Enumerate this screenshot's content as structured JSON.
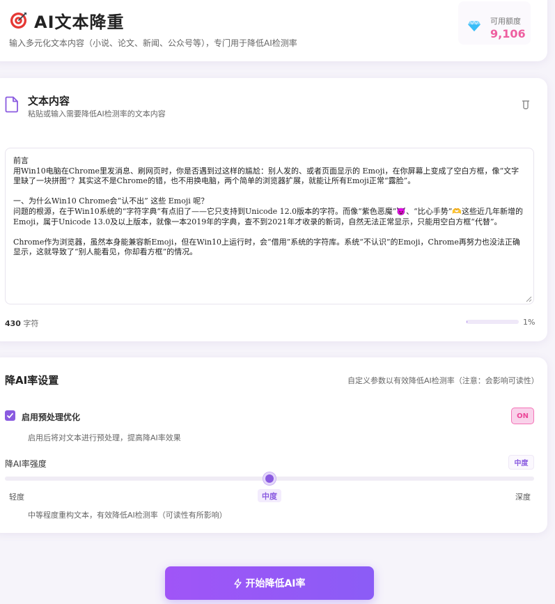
{
  "header": {
    "title": "AI文本降重",
    "subtitle": "输入多元化文本内容（小说、论文、新闻、公众号等），专门用于降低AI检测率",
    "quota_label": "可用额度",
    "quota_value": "9,106"
  },
  "text_section": {
    "title": "文本内容",
    "description": "粘贴或输入需要降低AI检测率的文本内容",
    "content": "前言\n用Win10电脑在Chrome里发消息、刷网页时，你是否遇到过这样的尴尬：别人发的、或者页面显示的 Emoji，在你屏幕上变成了空白方框，像“文字里缺了一块拼图”？其实这不是Chrome的错，也不用换电脑，两个简单的浏览器扩展，就能让所有Emoji正常“露脸”。\n\n一、为什么Win10 Chrome会“认不出” 这些 Emoji 呢？\n问题的根源，在于Win10系统的“字符字典”有点旧了——它只支持到Unicode 12.0版本的字符。而像“紫色恶魔”😈、“比心手势”🫶这些近几年新增的Emoji，属于Unicode 13.0及以上版本，就像一本2019年的字典，查不到2021年才收录的新词，自然无法正常显示，只能用空白方框“代替”。\n\nChrome作为浏览器，虽然本身能兼容新Emoji，但在Win10上运行时，会“借用”系统的字符库。系统“不认识”的Emoji，Chrome再努力也没法正确显示，这就导致了“别人能看见，你却看方框”的情况。",
    "char_count": "430",
    "char_unit": "字符",
    "progress_percent": 1,
    "progress_label": "1%"
  },
  "settings": {
    "title": "降AI率设置",
    "note": "自定义参数以有效降低AI检测率（注意：会影响可读性）",
    "preprocess_label": "启用预处理优化",
    "preprocess_checked": true,
    "preprocess_toggle": "ON",
    "preprocess_desc": "启用后将对文本进行预处理，提高降AI率效果",
    "strength_label": "降AI率强度",
    "strength_value": "中度",
    "strength_level": 0.5,
    "ticks": [
      "轻度",
      "中度",
      "深度"
    ],
    "strength_desc": "中等程度重构文本，有效降低AI检测率（可读性有所影响）"
  },
  "action": {
    "start_label": "开始降低AI率"
  },
  "colors": {
    "accent": "#8a5be0",
    "quota": "#ee5ea0",
    "toggle": "#ec4899"
  }
}
